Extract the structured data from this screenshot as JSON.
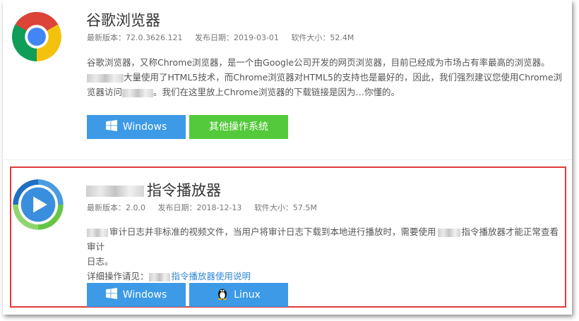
{
  "browser": {
    "name": "谷歌浏览器",
    "version_label": "最新版本：72.0.3626.121",
    "date_label": "发布日期：2019-03-01",
    "size_label": "软件大小：52.4M",
    "desc_part1": "谷歌浏览器，又称Chrome浏览器，是一个由Google公司开发的网页浏览器，目前已经成为市场占有率最高的浏览器。",
    "desc_part2": "大量使用了HTML5技术，而Chrome浏览器对HTML5的支持也是最好的，因此，我们强烈建议您使用Chrome浏览器访问",
    "desc_part3": "。我们在这里放上Chrome浏览器的下载链接是因为…你懂的。",
    "buttons": {
      "windows": "Windows",
      "other_os": "其他操作系统"
    },
    "icon": "chrome-logo-icon"
  },
  "player": {
    "name_suffix": "指令播放器",
    "version_label": "最新版本：2.0.0",
    "date_label": "发布日期：2018-12-13",
    "size_label": "软件大小：57.5M",
    "desc_part1": "审计日志并非标准的视频文件，当用户将审计日志下载到本地进行播放时，需要使用",
    "desc_part2": "指令播放器才能正常查看审计",
    "desc_part3": "日志。",
    "guide_prefix": "详细操作请见：",
    "guide_link": "指令播放器使用说明",
    "buttons": {
      "windows": "Windows",
      "linux": "Linux"
    },
    "icon": "play-circle-icon"
  },
  "colors": {
    "blue_button": "#3d9ae6",
    "green_button": "#53c93b",
    "highlight_border": "#e03b3b",
    "link": "#2f86d6"
  }
}
